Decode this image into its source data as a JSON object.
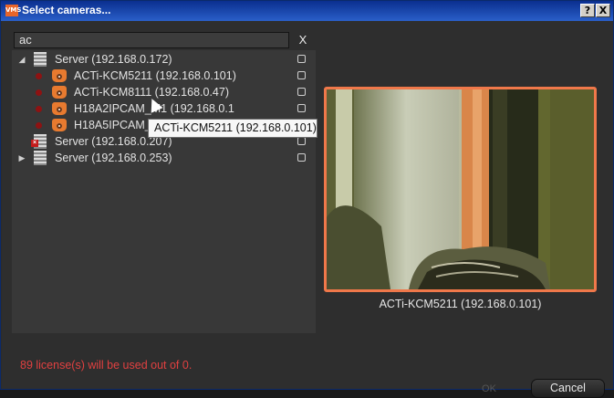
{
  "window": {
    "title": "Select cameras...",
    "app_icon_text": "VMS",
    "help_button": "?",
    "close_button": "X"
  },
  "search": {
    "value": "ac",
    "clear_label": "X"
  },
  "tree": {
    "servers": [
      {
        "label": "Server (192.168.0.172)",
        "expanded": true,
        "status": "online"
      },
      {
        "label": "Server (192.168.0.207)",
        "expanded": false,
        "status": "offline"
      },
      {
        "label": "Server (192.168.0.253)",
        "expanded": false,
        "status": "online"
      }
    ],
    "cameras": [
      {
        "label": "ACTi-KCM5211 (192.168.0.101)"
      },
      {
        "label": "ACTi-KCM8111 (192.168.0.47)"
      },
      {
        "label": "H18A2IPCAM_M1 (192.168.0.1"
      },
      {
        "label": "H18A5IPCAM_M1 (192.168.0.118)"
      }
    ]
  },
  "tooltip": {
    "text": "ACTi-KCM5211 (192.168.0.101)"
  },
  "preview": {
    "caption": "ACTi-KCM5211 (192.168.0.101)",
    "border_color": "#f0784a"
  },
  "footer": {
    "license_text": "89 license(s) will be used out of 0.",
    "ok_label": "OK",
    "cancel_label": "Cancel"
  },
  "colors": {
    "license_text": "#e04040",
    "title_bar": "#0a2f8f",
    "camera_icon": "#e87a2f"
  }
}
